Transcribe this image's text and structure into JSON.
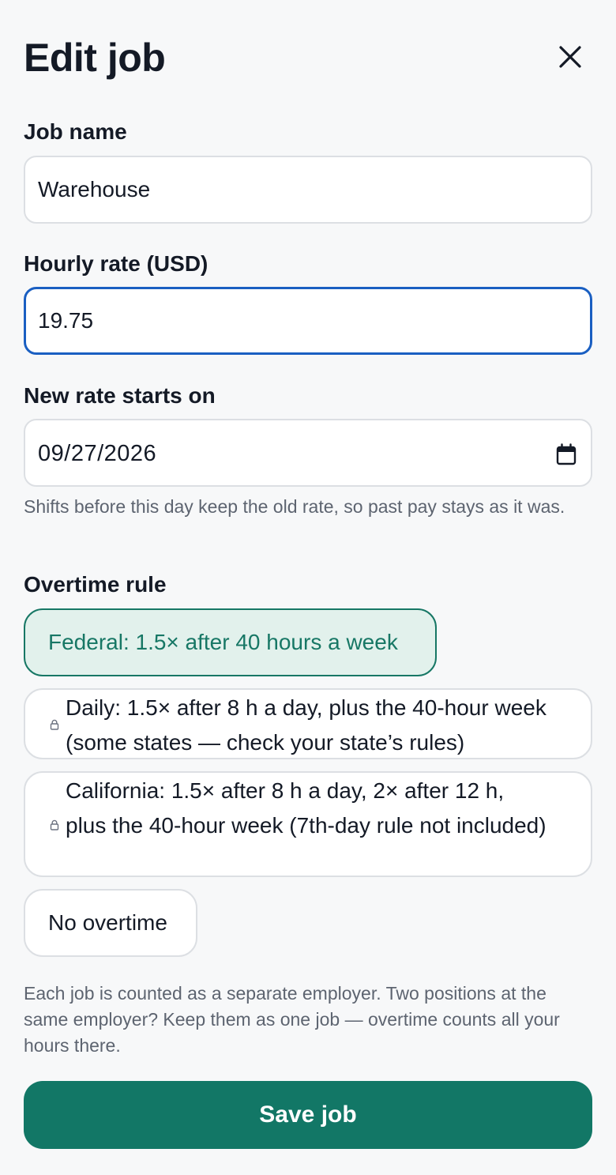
{
  "dialog": {
    "title": "Edit job"
  },
  "job_name": {
    "label": "Job name",
    "value": "Warehouse"
  },
  "hourly_rate": {
    "label": "Hourly rate (USD)",
    "value": "19.75"
  },
  "start_date": {
    "label": "New rate starts on",
    "value": "09/27/2026",
    "help": "Shifts before this day keep the old rate, so past pay stays as it was."
  },
  "overtime": {
    "label": "Overtime rule",
    "options": [
      {
        "label": "Federal: 1.5× after 40 hours a week",
        "selected": true,
        "locked": false
      },
      {
        "label": "Daily: 1.5× after 8 h a day, plus the 40-hour week (some states — check your state’s rules)",
        "selected": false,
        "locked": true
      },
      {
        "label": "California: 1.5× after 8 h a day, 2× after 12 h, plus the 40-hour week (7th-day rule not included)",
        "selected": false,
        "locked": true
      },
      {
        "label": "No overtime",
        "selected": false,
        "locked": false
      }
    ],
    "note": "Each job is counted as a separate employer. Two positions at the same employer? Keep them as one job — overtime counts all your hours there."
  },
  "actions": {
    "save_label": "Save job"
  },
  "colors": {
    "accent": "#127766",
    "focus": "#1a5fc2",
    "selected_bg": "#e2f1ec"
  }
}
